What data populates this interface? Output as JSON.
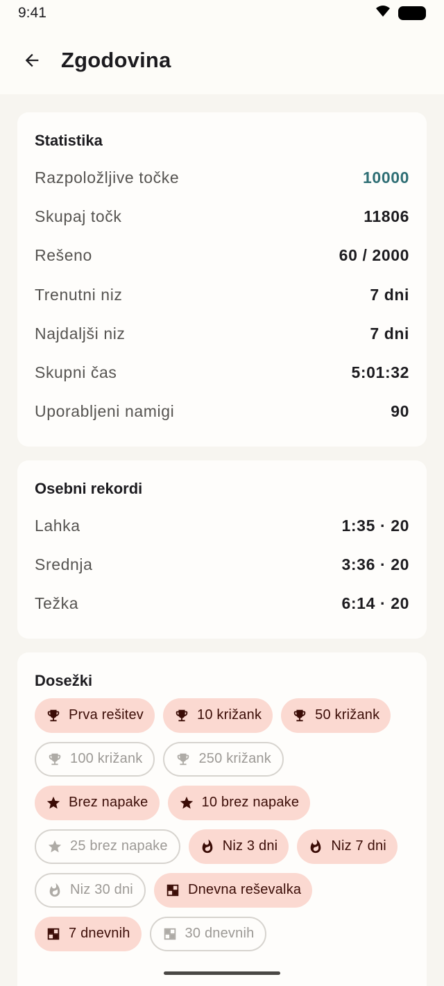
{
  "status_bar": {
    "time": "9:41"
  },
  "app_bar": {
    "title": "Zgodovina"
  },
  "stats": {
    "title": "Statistika",
    "rows": [
      {
        "label": "Razpoložljive točke",
        "value": "10000"
      },
      {
        "label": "Skupaj točk",
        "value": "11806"
      },
      {
        "label": "Rešeno",
        "value": "60 / 2000"
      },
      {
        "label": "Trenutni niz",
        "value": "7 dni"
      },
      {
        "label": "Najdaljši niz",
        "value": "7 dni"
      },
      {
        "label": "Skupni čas",
        "value": "5:01:32"
      },
      {
        "label": "Uporabljeni namigi",
        "value": "90"
      }
    ]
  },
  "records": {
    "title": "Osebni rekordi",
    "rows": [
      {
        "label": "Lahka",
        "value": "1:35 · 20"
      },
      {
        "label": "Srednja",
        "value": "3:36 · 20"
      },
      {
        "label": "Težka",
        "value": "6:14 · 20"
      }
    ]
  },
  "achievements": {
    "title": "Dosežki",
    "items": [
      {
        "label": "Prva rešitev",
        "icon": "trophy-icon",
        "earned": true
      },
      {
        "label": "10 križank",
        "icon": "trophy-icon",
        "earned": true
      },
      {
        "label": "50 križank",
        "icon": "trophy-icon",
        "earned": true
      },
      {
        "label": "100 križank",
        "icon": "trophy-icon",
        "earned": false
      },
      {
        "label": "250 križank",
        "icon": "trophy-icon",
        "earned": false
      },
      {
        "label": "Brez napake",
        "icon": "star-icon",
        "earned": true
      },
      {
        "label": "10 brez napake",
        "icon": "star-icon",
        "earned": true
      },
      {
        "label": "25 brez napake",
        "icon": "star-icon",
        "earned": false
      },
      {
        "label": "Niz 3 dni",
        "icon": "flame-icon",
        "earned": true
      },
      {
        "label": "Niz 7 dni",
        "icon": "flame-icon",
        "earned": true
      },
      {
        "label": "Niz 30 dni",
        "icon": "flame-icon",
        "earned": false
      },
      {
        "label": "Dnevna reševalka",
        "icon": "grid-icon",
        "earned": true
      },
      {
        "label": "7 dnevnih",
        "icon": "grid-icon",
        "earned": true
      },
      {
        "label": "30 dnevnih",
        "icon": "grid-icon",
        "earned": false
      }
    ]
  },
  "colors": {
    "accent": "#2e6e74",
    "chip_earned_bg": "#fbd9d1",
    "background": "#f7f5f0"
  }
}
